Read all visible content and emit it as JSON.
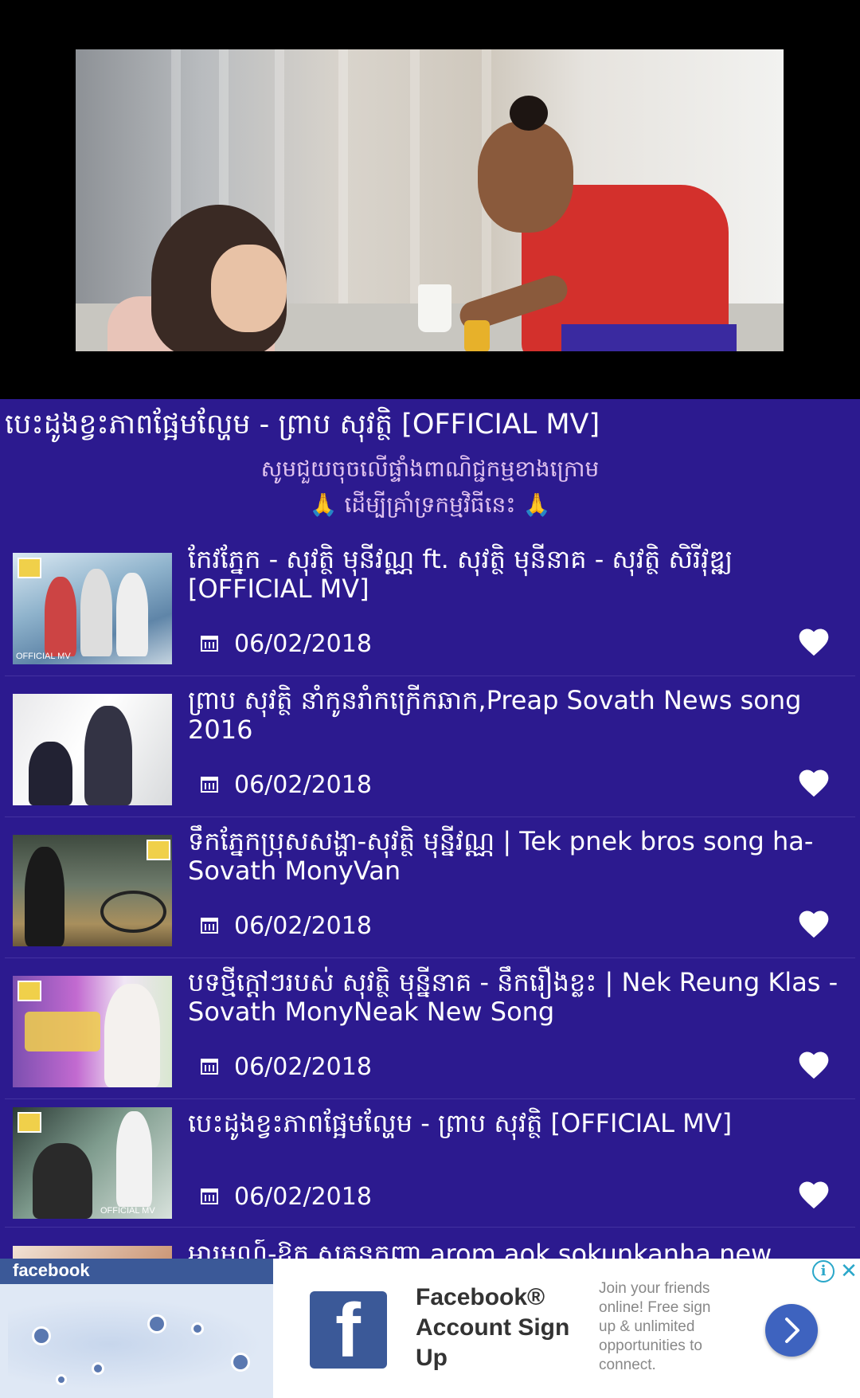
{
  "player": {
    "now_playing_title": "បេះដូងខ្វះភាពផ្អែមល្ហែម - ព្រាប សុវត្ថិ [OFFICIAL MV]"
  },
  "support_message": {
    "line1": "សូមជួយចុចលើផ្ទាំងពាណិជ្ជកម្មខាងក្រោម",
    "line2": "ដើម្បីគ្រាំទ្រកម្មវិធីនេះ",
    "emoji": "🙏"
  },
  "playlist": [
    {
      "title": "កែវភ្នែក - សុវត្ថិ មុនីវណ្ណ ft. សុវត្ថិ មុនីនាគ - សុវត្ថិ សិរីវុឌ្ឍ [OFFICIAL MV]",
      "date": "06/02/2018",
      "thumb_caption": "OFFICIAL MV"
    },
    {
      "title": "ព្រាប សុវត្ថិ នាំកូនរាំកក្រើកឆាក,Preap Sovath News song 2016",
      "date": "06/02/2018",
      "thumb_caption": ""
    },
    {
      "title": "ទឹកភ្នែកប្រុសសង្ហា-សុវត្ថិ មុន្នីវណ្ណ | Tek pnek bros song ha-Sovath MonyVan",
      "date": "06/02/2018",
      "thumb_caption": ""
    },
    {
      "title": "បទថ្មីក្តៅៗរបស់ សុវត្ថិ មុន្នីនាគ - នឹករឿងខ្លះ | Nek Reung Klas - Sovath MonyNeak New Song",
      "date": "06/02/2018",
      "thumb_caption": ""
    },
    {
      "title": "បេះដូងខ្វះភាពផ្អែមល្ហែម - ព្រាប សុវត្ថិ [OFFICIAL MV]",
      "date": "06/02/2018",
      "thumb_caption": "OFFICIAL MV"
    }
  ],
  "partial_item": {
    "title": "អារម្មណ៍-ឱក សុគន្ធកញ្ញា arom aok sokunkanha new song"
  },
  "ad": {
    "image_brand": "facebook",
    "title": "Facebook® Account Sign Up",
    "body": "Join your friends online! Free sign up & unlimited opportunities to connect.",
    "info_icon": "i",
    "close_icon": "✕"
  },
  "colors": {
    "background": "#2c1a8f",
    "support_text": "#e0c2ee",
    "facebook_blue": "#3b5998",
    "cta_blue": "#3e63bf"
  }
}
